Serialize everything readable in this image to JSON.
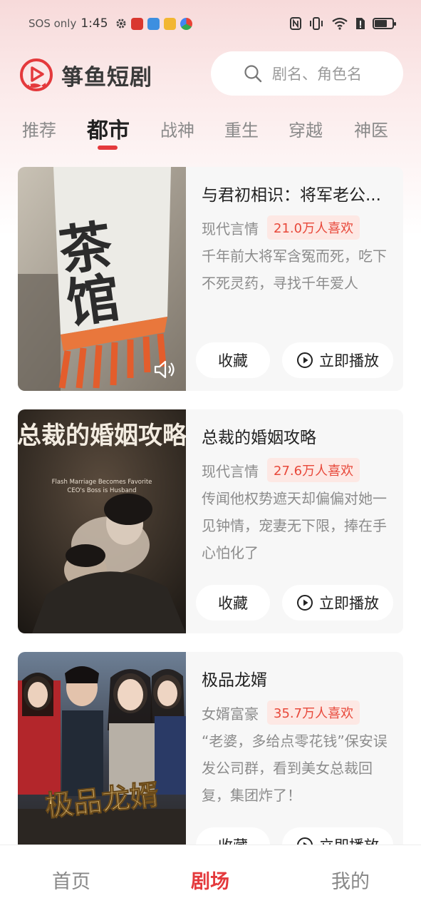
{
  "status_bar": {
    "carrier": "SOS only",
    "time": "1:45",
    "icons": [
      "gear-icon",
      "app-icon-red",
      "app-icon-blue",
      "app-icon-yellow",
      "app-icon-multicolor",
      "nfc-icon",
      "vibrate-icon",
      "wifi-icon",
      "sim-icon",
      "battery-icon"
    ]
  },
  "header": {
    "app_name": "箏鱼短剧",
    "search_placeholder": "剧名、角色名"
  },
  "tabs": [
    {
      "label": "推荐"
    },
    {
      "label": "都市",
      "active": true
    },
    {
      "label": "战神"
    },
    {
      "label": "重生"
    },
    {
      "label": "穿越"
    },
    {
      "label": "神医"
    }
  ],
  "dramas": [
    {
      "title": "与君初相识：将军老公...",
      "genre": "现代言情",
      "likes": "21.0万人喜欢",
      "description": "千年前大将军含冤而死，吃下不死灵药，寻找千年爱人",
      "cover_text": "茶馆",
      "favorite_label": "收藏",
      "play_label": "立即播放"
    },
    {
      "title": "总裁的婚姻攻略",
      "genre": "现代言情",
      "likes": "27.6万人喜欢",
      "description": "传闻他权势遮天却偏偏对她一见钟情，宠妻无下限，捧在手心怕化了",
      "cover_title": "总裁的婚姻攻略",
      "cover_subtitle_line1": "Flash Marriage Becomes Favorite",
      "cover_subtitle_line2": "CEO's Boss is Husband",
      "favorite_label": "收藏",
      "play_label": "立即播放"
    },
    {
      "title": "极品龙婿",
      "genre": "女婿富豪",
      "likes": "35.7万人喜欢",
      "description": "“老婆，多给点零花钱”保安误发公司群，看到美女总裁回复，集团炸了！",
      "cover_title": "极品龙婿",
      "favorite_label": "收藏",
      "play_label": "立即播放"
    }
  ],
  "bottom_nav": [
    {
      "label": "首页"
    },
    {
      "label": "剧场",
      "active": true
    },
    {
      "label": "我的"
    }
  ],
  "colors": {
    "accent": "#e4393c",
    "likes_text": "#e8483a",
    "likes_bg": "#fde8e4",
    "header_gradient_top": "#f7dada"
  }
}
